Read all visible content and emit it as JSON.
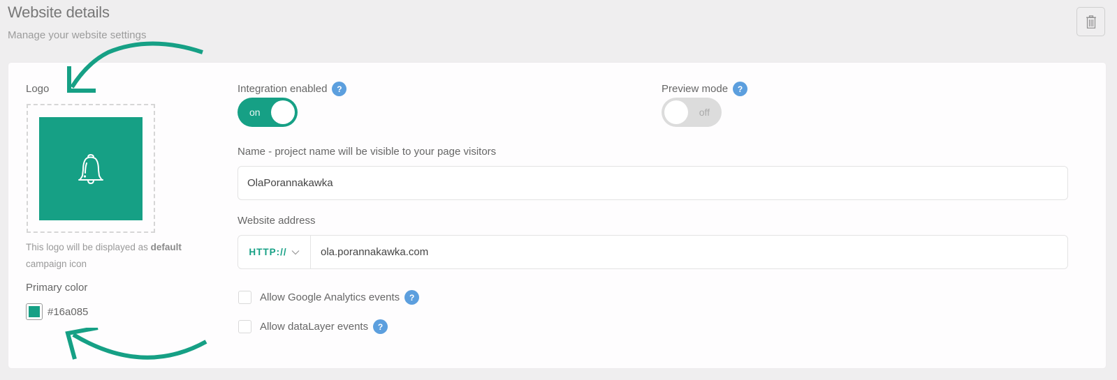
{
  "header": {
    "title": "Website details",
    "subtitle": "Manage your website settings",
    "delete_icon": "trash-icon"
  },
  "logo": {
    "label": "Logo",
    "icon": "bell-icon",
    "background_color": "#16a085",
    "hint_text": "This logo will be displayed as ",
    "hint_bold": "default",
    "hint_text_end": " campaign icon"
  },
  "primary_color": {
    "label": "Primary color",
    "value": "#16a085"
  },
  "integration": {
    "label": "Integration enabled",
    "help": "?",
    "state": "on"
  },
  "preview": {
    "label": "Preview mode",
    "help": "?",
    "state": "off"
  },
  "name_field": {
    "label": "Name - project name will be visible to your page visitors",
    "value": "OlaPorannakawka"
  },
  "address_field": {
    "label": "Website address",
    "protocol": "HTTP://",
    "value": "ola.porannakawka.com"
  },
  "checkboxes": [
    {
      "label": "Allow Google Analytics events",
      "checked": false,
      "help": "?"
    },
    {
      "label": "Allow dataLayer events",
      "checked": false,
      "help": "?"
    }
  ],
  "colors": {
    "accent": "#16a085",
    "help_badge": "#5c9fde",
    "annotation_arrow": "#16a085"
  }
}
